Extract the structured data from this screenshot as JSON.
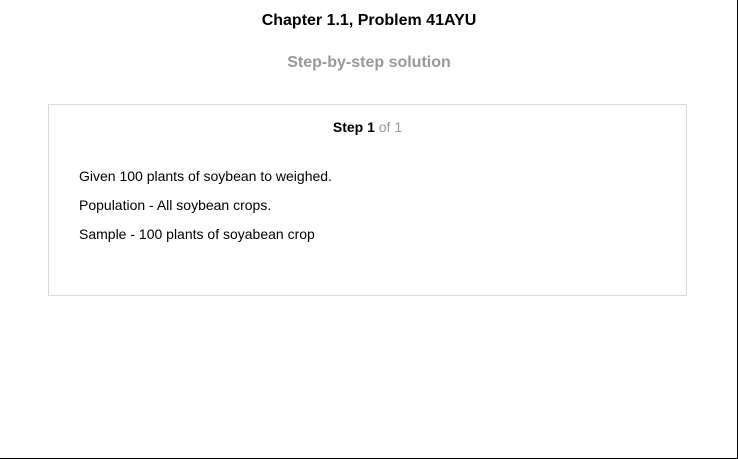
{
  "header": {
    "title": "Chapter 1.1, Problem 41AYU",
    "subtitle": "Step-by-step solution"
  },
  "step": {
    "label": "Step 1",
    "of_text": "of 1",
    "lines": [
      "Given 100 plants of soybean to weighed.",
      "Population - All soybean crops.",
      "Sample - 100 plants of soyabean crop"
    ]
  },
  "colors": {
    "muted_text": "#999999",
    "card_border": "#dcdcdc"
  }
}
